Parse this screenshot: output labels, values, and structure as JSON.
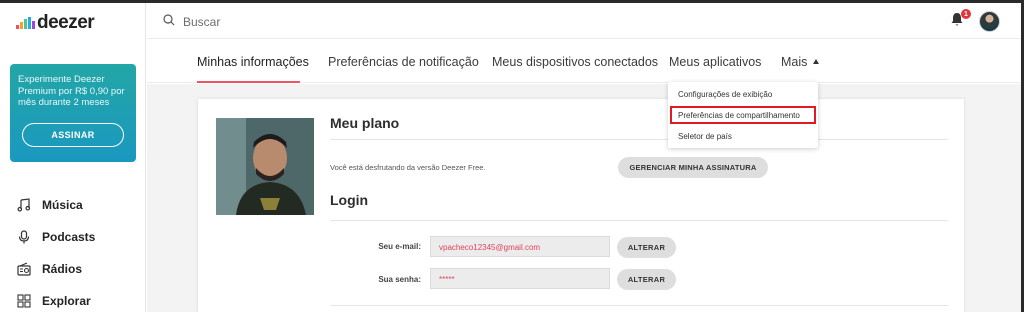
{
  "app": {
    "logo_text": "deezer",
    "brand_colors": [
      "#ef5466",
      "#f7a128",
      "#45c99a",
      "#2fa7e0",
      "#9f47db"
    ]
  },
  "search": {
    "placeholder": "Buscar"
  },
  "notifications": {
    "count": "1"
  },
  "promo": {
    "text": "Experimente Deezer Premium por R$ 0,90 por mês durante 2 meses",
    "button_label": "ASSINAR"
  },
  "sidebar": {
    "items": [
      {
        "label": "Música",
        "icon": "music-note-icon"
      },
      {
        "label": "Podcasts",
        "icon": "microphone-icon"
      },
      {
        "label": "Rádios",
        "icon": "radio-icon"
      },
      {
        "label": "Explorar",
        "icon": "grid-icon"
      }
    ]
  },
  "tabs": [
    {
      "label": "Minhas informações",
      "active": true
    },
    {
      "label": "Preferências de notificação"
    },
    {
      "label": "Meus dispositivos conectados"
    },
    {
      "label": "Meus aplicativos"
    },
    {
      "label": "Mais"
    }
  ],
  "dropdown": {
    "items": [
      {
        "label": "Configurações de exibição"
      },
      {
        "label": "Preferências de compartilhamento",
        "highlighted": true
      },
      {
        "label": "Seletor de país"
      }
    ]
  },
  "plan": {
    "title": "Meu plano",
    "text": "Você está desfrutando da versão Deezer Free.",
    "button_label": "GERENCIAR MINHA ASSINATURA"
  },
  "login": {
    "title": "Login",
    "email_label": "Seu e-mail:",
    "email_value": "vpacheco12345@gmail.com",
    "password_label": "Sua senha:",
    "password_value": "*****",
    "change_label": "ALTERAR"
  }
}
